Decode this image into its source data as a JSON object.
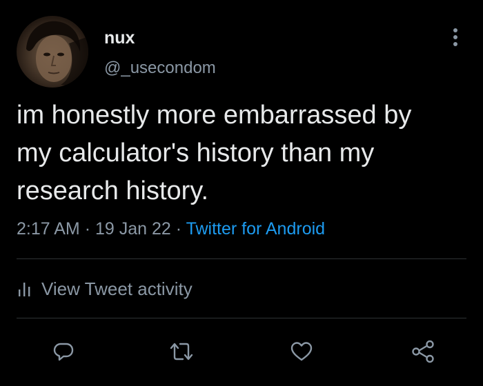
{
  "author": {
    "display_name": "nux",
    "handle": "@_usecondom"
  },
  "tweet": {
    "text": "im honestly more embarrassed by\nmy calculator's history than my\nresearch history.",
    "time": "2:17 AM",
    "separator": "·",
    "date": "19 Jan 22",
    "source": "Twitter for Android"
  },
  "activity": {
    "label": "View Tweet activity",
    "icon": "bar-chart-icon"
  },
  "actions": {
    "reply_icon": "reply-icon",
    "retweet_icon": "retweet-icon",
    "like_icon": "heart-icon",
    "share_icon": "share-icon"
  },
  "colors": {
    "background": "#000000",
    "primary_text": "#e7e9ea",
    "secondary_text": "#8b98a5",
    "link": "#1d9bf0",
    "divider": "#2f3336"
  }
}
